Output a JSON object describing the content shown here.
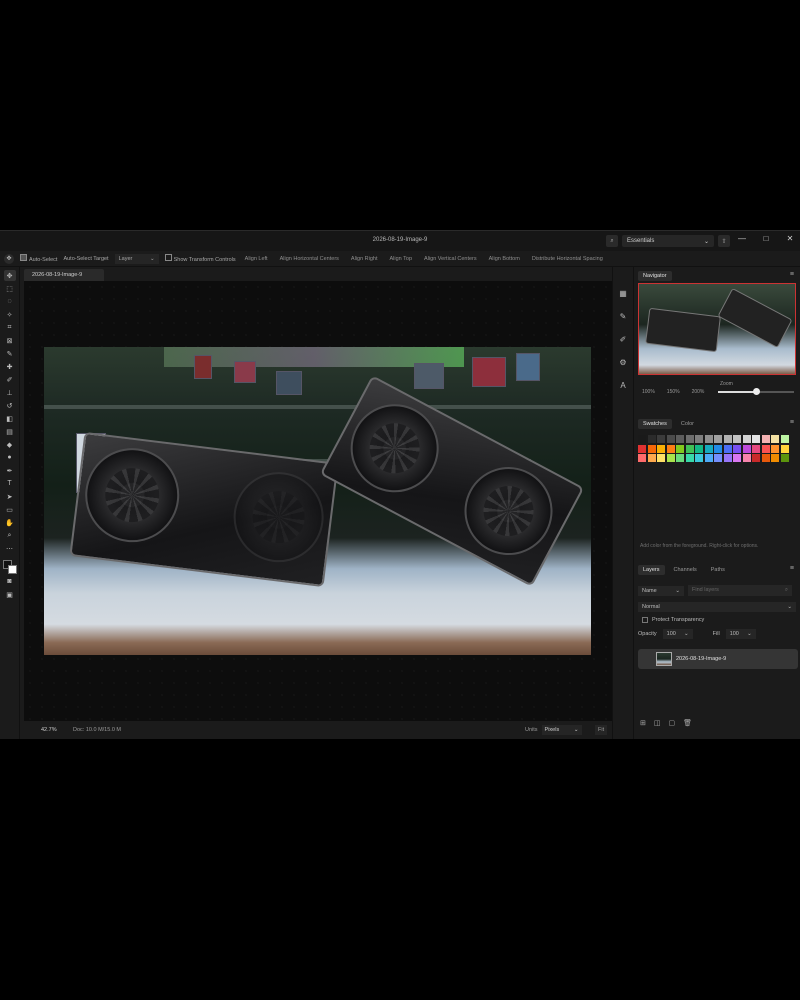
{
  "window": {
    "title": "2026-08-19-Image-9",
    "workspace": "Essentials",
    "controls": [
      "—",
      "□",
      "✕"
    ]
  },
  "options_bar": {
    "auto_select_label": "Auto-Select",
    "auto_select_target_label": "Auto-Select Target",
    "auto_select_target_value": "Layer",
    "show_transform_label": "Show Transform Controls",
    "buttons": [
      "Align Left",
      "Align Horizontal Centers",
      "Align Right",
      "Align Top",
      "Align Vertical Centers",
      "Align Bottom",
      "Distribute Horizontal Spacing"
    ]
  },
  "document_tab": "2026-08-19-Image-9",
  "status_bar": {
    "zoom": "42.7%",
    "doc_info": "Doc: 10.0 M/15.0 M",
    "units_label": "Units",
    "units_value": "Pixels",
    "fit_label": "Fit"
  },
  "navigator": {
    "tab": "Navigator",
    "zoom_label": "Zoom",
    "presets": [
      "100%",
      "150%",
      "200%"
    ],
    "zoom_level_fraction": 0.5
  },
  "swatches": {
    "tabs": [
      "Swatches",
      "Color"
    ],
    "colors": [
      "#1a1a1a",
      "#2b2b2b",
      "#3b3b3b",
      "#4b4b4b",
      "#5c5c5c",
      "#6d6d6d",
      "#7e7e7e",
      "#8f8f8f",
      "#a0a0a0",
      "#b1b1b1",
      "#c2c2c2",
      "#d3d3d3",
      "#e4e4e4",
      "#f5b3b3",
      "#f5e2a3",
      "#bdf5a3",
      "#e03131",
      "#f76707",
      "#fab005",
      "#fd7e14",
      "#82c91e",
      "#40c057",
      "#12b886",
      "#15aabf",
      "#228be6",
      "#4c6ef5",
      "#7950f2",
      "#be4bdb",
      "#e64980",
      "#fa5252",
      "#ff922b",
      "#ffd43b",
      "#ff6b6b",
      "#ffa94d",
      "#ffe066",
      "#a9e34b",
      "#69db7c",
      "#38d9a9",
      "#3bc9db",
      "#4dabf7",
      "#748ffc",
      "#9775fa",
      "#da77f2",
      "#f783ac",
      "#c92a2a",
      "#e8590c",
      "#f08c00",
      "#5c940d"
    ],
    "hint": "Add color from the foreground. Right-click for options."
  },
  "layers": {
    "tabs": [
      "Layers",
      "Channels",
      "Paths"
    ],
    "filter_label": "Name",
    "search_placeholder": "Find layers",
    "blend_mode": "Normal",
    "protect_label": "Protect Transparency",
    "opacity_label": "Opacity",
    "opacity_value": "100",
    "fill_label": "Fill",
    "fill_value": "100",
    "layer_name": "2026-08-19-Image-9"
  },
  "colors": {
    "accent": "#e0e0e0",
    "app_bg": "#1b1b1b",
    "canvas_bg": "#0d0d0d"
  }
}
